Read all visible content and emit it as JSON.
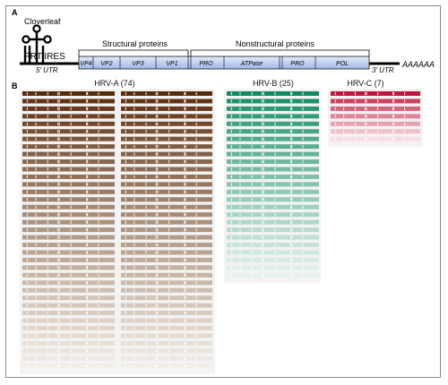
{
  "panel_a": {
    "letter": "A",
    "cloverleaf_label": "Cloverleaf",
    "prt_ires_label": "PRT IRES",
    "utr5_label": "5′ UTR",
    "utr3_label": "3′ UTR",
    "polya_label": "AAAAAA",
    "structural_label": "Structural proteins",
    "nonstructural_label": "Nonstructural proteins",
    "genes": [
      "VP4",
      "VP2",
      "VP3",
      "VP1",
      "PRO",
      "ATPase",
      "PRO",
      "POL"
    ]
  },
  "panel_b": {
    "letter": "B",
    "groups": [
      {
        "id": "hrv-a",
        "label": "HRV-A (74)",
        "count": 74,
        "top_color": "#5a2a08",
        "bottom_color": "#f2ede6"
      },
      {
        "id": "hrv-b",
        "label": "HRV-B (25)",
        "count": 25,
        "top_color": "#0f8a64",
        "bottom_color": "#e6f2ec"
      },
      {
        "id": "hrv-c",
        "label": "HRV-C (7)",
        "count": 7,
        "top_color": "#c2143c",
        "bottom_color": "#f6dde2"
      }
    ]
  }
}
